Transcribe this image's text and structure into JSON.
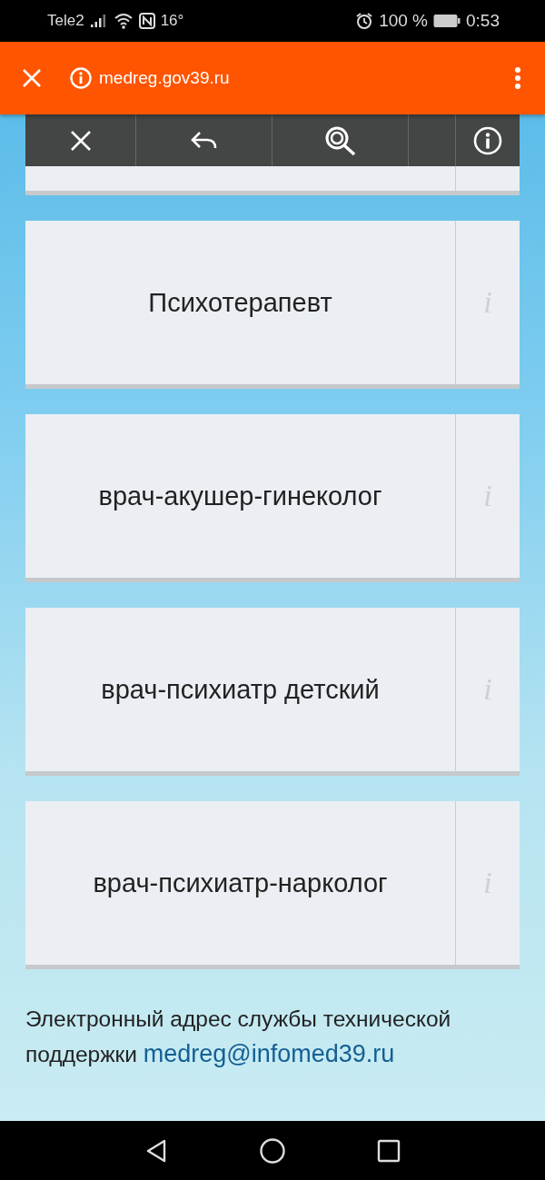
{
  "status_bar": {
    "carrier": "Tele2",
    "temperature": "16°",
    "battery": "100 %",
    "time": "0:53"
  },
  "browser": {
    "url": "medreg.gov39.ru"
  },
  "cards": [
    {
      "kind": "covered"
    },
    {
      "kind": "full",
      "title": "Психотерапевт",
      "info": "i"
    },
    {
      "kind": "full",
      "title": "врач-акушер-гинеколог",
      "info": "i"
    },
    {
      "kind": "full",
      "title": "врач-психиатр детский",
      "info": "i"
    },
    {
      "kind": "full",
      "title": "врач-психиатр-нарколог",
      "info": "i"
    }
  ],
  "footer": {
    "text": "Электронный адрес службы технической поддержки",
    "email": "medreg@infomed39.ru"
  }
}
